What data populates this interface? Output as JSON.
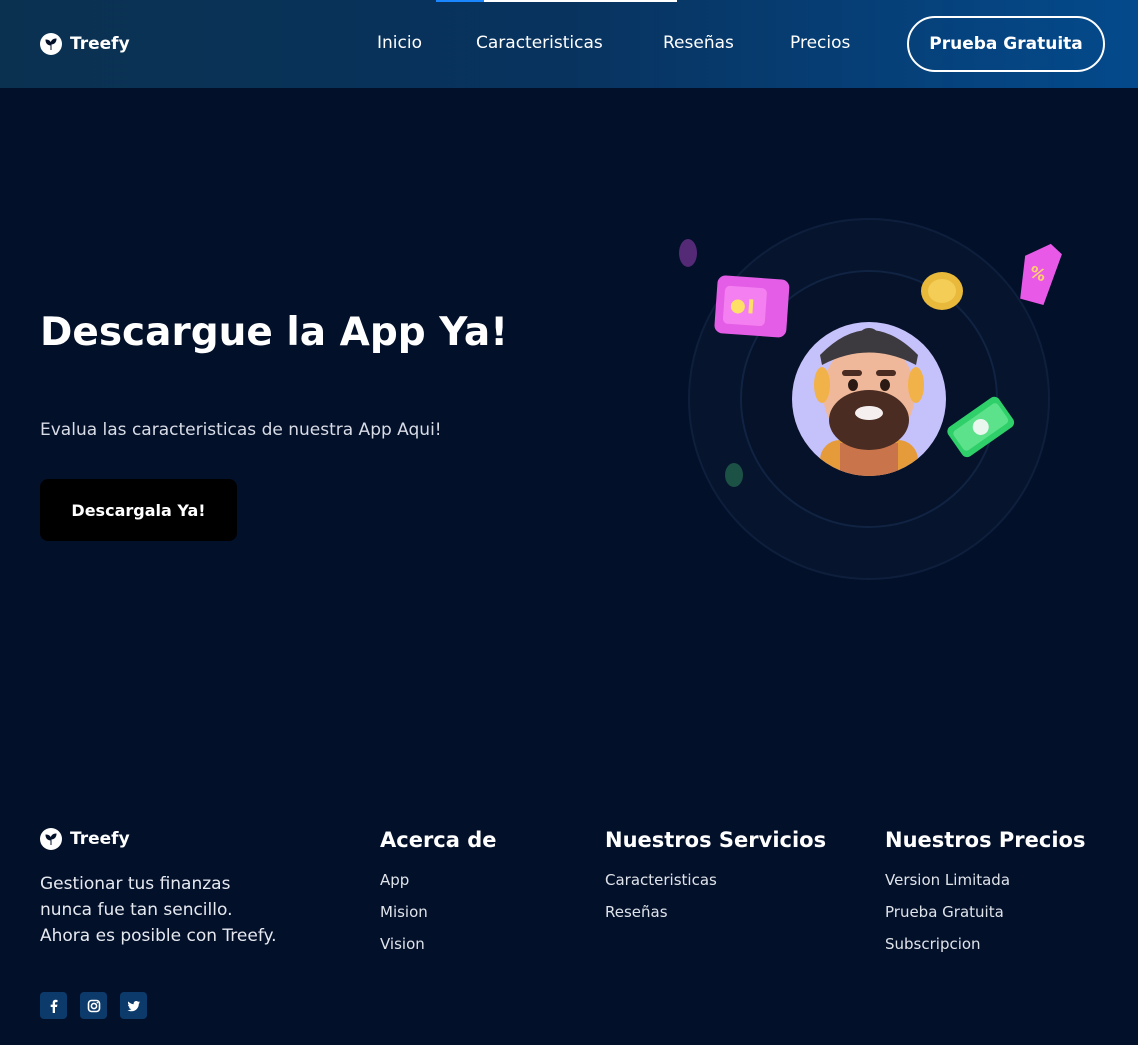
{
  "brand": {
    "name": "Treefy",
    "logo_icon": "leaf-logo-icon"
  },
  "header": {
    "nav": [
      {
        "label": "Inicio"
      },
      {
        "label": "Caracteristicas"
      },
      {
        "label": "Reseñas"
      },
      {
        "label": "Precios"
      }
    ],
    "cta_label": "Prueba Gratuita",
    "scroll_progress_percent": 20
  },
  "hero": {
    "title": "Descargue la App Ya!",
    "subtitle": "Evalua las caracteristicas de nuestra App Aqui!",
    "button_label": "Descargala Ya!",
    "illustration_icons": [
      "avatar-man-icon",
      "pink-safe-icon",
      "gold-coin-icon",
      "discount-tag-icon",
      "money-stack-icon"
    ]
  },
  "footer": {
    "brand_name": "Treefy",
    "tagline": [
      "Gestionar tus finanzas",
      "nunca fue tan sencillo.",
      "Ahora es posible con Treefy."
    ],
    "columns": [
      {
        "title": "Acerca de",
        "links": [
          "App",
          "Mision",
          "Vision"
        ]
      },
      {
        "title": "Nuestros Servicios",
        "links": [
          "Caracteristicas",
          "Reseñas"
        ]
      },
      {
        "title": "Nuestros Precios",
        "links": [
          "Version Limitada",
          "Prueba Gratuita",
          "Subscripcion"
        ]
      }
    ],
    "social": [
      "facebook-icon",
      "instagram-icon",
      "twitter-icon"
    ]
  },
  "colors": {
    "background": "#03102a",
    "header_gradient_start": "#0a3150",
    "header_gradient_end": "#044a8c",
    "button_dark": "#000000",
    "social_bg": "#0c3a6b",
    "accent_blue": "#1a86ff"
  }
}
